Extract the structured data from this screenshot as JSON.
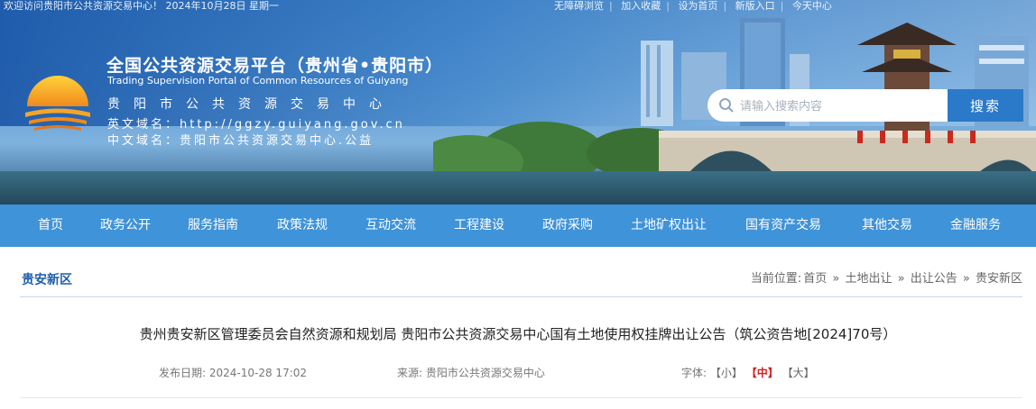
{
  "topbar": {
    "welcome": "欢迎访问贵阳市公共资源交易中心！ 2024年10月28日 星期一",
    "links": [
      "无障碍浏览",
      "加入收藏",
      "设为首页",
      "新版入口",
      "今天中心"
    ]
  },
  "header": {
    "title_cn": "全国公共资源交易平台（贵州省•贵阳市）",
    "title_en": "Trading Supervision Portal of Common Resources of Guiyang",
    "org": "贵阳市公共资源交易中心",
    "domain_en": "英文域名：http://ggzy.guiyang.gov.cn",
    "domain_cn": "中文域名：贵阳市公共资源交易中心.公益"
  },
  "search": {
    "placeholder": "请输入搜索内容",
    "button": "搜索"
  },
  "nav": [
    "首页",
    "政务公开",
    "服务指南",
    "政策法规",
    "互动交流",
    "工程建设",
    "政府采购",
    "土地矿权出让",
    "国有资产交易",
    "其他交易",
    "金融服务"
  ],
  "section": {
    "title": "贵安新区",
    "breadcrumb_prefix": "当前位置:",
    "breadcrumb": [
      "首页",
      "土地出让",
      "出让公告",
      "贵安新区"
    ],
    "separator": "»"
  },
  "article": {
    "title": "贵州贵安新区管理委员会自然资源和规划局 贵阳市公共资源交易中心国有土地使用权挂牌出让公告（筑公资告地[2024]70号）",
    "publish_label": "发布日期:",
    "publish_date": "2024-10-28 17:02",
    "source_label": "来源:",
    "source": "贵阳市公共资源交易中心",
    "font_label": "字体:",
    "font_sizes": [
      "【小】",
      "【中】",
      "【大】"
    ]
  },
  "colors": {
    "nav_bg": "#3f93d9",
    "accent": "#1e5fa8",
    "active_font": "#d42020"
  }
}
